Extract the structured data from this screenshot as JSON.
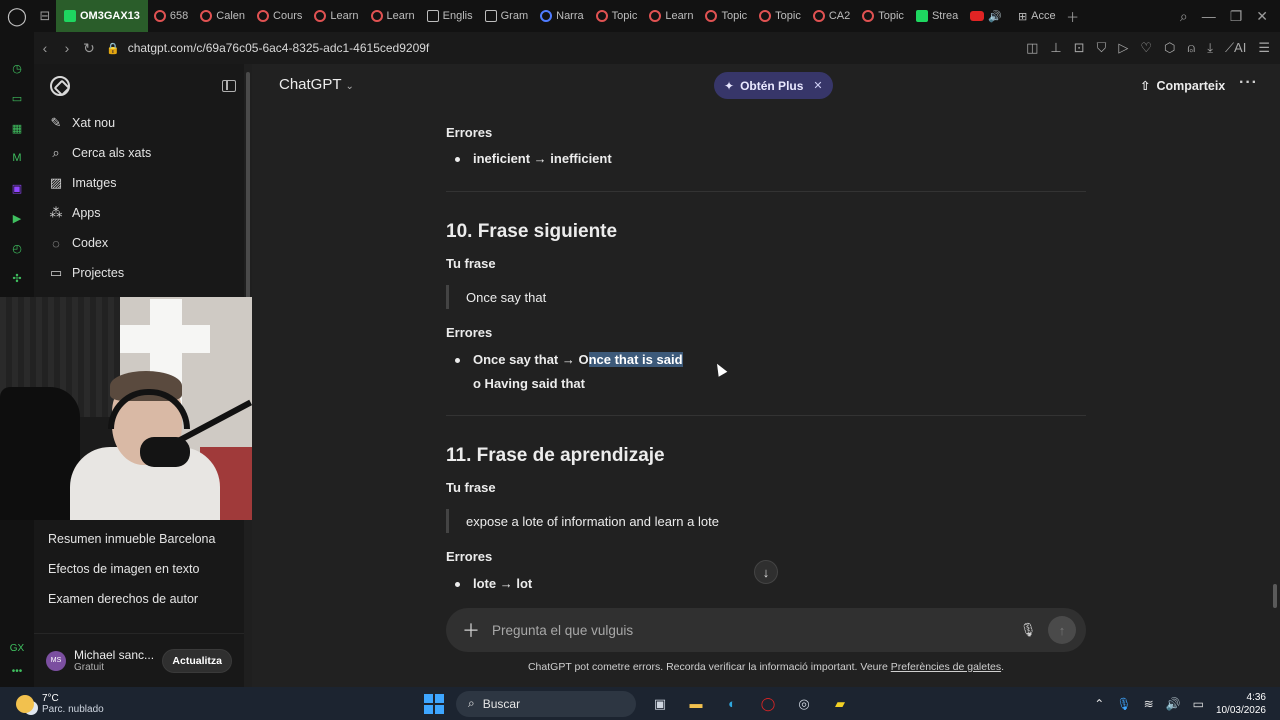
{
  "browser": {
    "tabs": [
      {
        "label": "OM3GAX13",
        "active": true
      },
      {
        "label": "658"
      },
      {
        "label": "Calen"
      },
      {
        "label": "Cours"
      },
      {
        "label": "Learn"
      },
      {
        "label": "Learn"
      },
      {
        "label": "Englis"
      },
      {
        "label": "Gram"
      },
      {
        "label": "Narra"
      },
      {
        "label": "Topic"
      },
      {
        "label": "Learn"
      },
      {
        "label": "Topic"
      },
      {
        "label": "Topic"
      },
      {
        "label": "CA2"
      },
      {
        "label": "Topic"
      },
      {
        "label": "Strea"
      },
      {
        "label": ""
      },
      {
        "label": "Acce"
      }
    ],
    "url": "chatgpt.com/c/69a76c05-6ac4-8325-adc1-4615ced9209f",
    "ai_label": "AI"
  },
  "sidebar": {
    "items": [
      {
        "icon": "new-chat-icon",
        "label": "Xat nou"
      },
      {
        "icon": "search-icon",
        "label": "Cerca als xats"
      },
      {
        "icon": "images-icon",
        "label": "Imatges"
      },
      {
        "icon": "apps-icon",
        "label": "Apps"
      },
      {
        "icon": "codex-icon",
        "label": "Codex"
      },
      {
        "icon": "projects-icon",
        "label": "Projectes"
      }
    ],
    "chats": [
      "Resumen inmueble Barcelona",
      "Efectos de imagen en texto",
      "Examen derechos de autor"
    ],
    "profile": {
      "initials": "MS",
      "name": "Michael sanc...",
      "plan": "Gratuit",
      "update_label": "Actualitza"
    }
  },
  "header": {
    "model": "ChatGPT",
    "plus_label": "Obtén Plus",
    "share_label": "Comparteix"
  },
  "content": {
    "errores_label": "Errores",
    "tu_frase_label": "Tu frase",
    "block0": {
      "error": "ineficient → inefficient"
    },
    "section10": {
      "title": "10. Frase siguiente",
      "phrase": "Once say that",
      "error_prefix": "Once say that → O",
      "error_highlight": "nce that is said",
      "alt": "o Having said that"
    },
    "section11": {
      "title": "11. Frase de aprendizaje",
      "phrase": "expose a lote of information and learn a lote",
      "error": "lote → lot"
    }
  },
  "composer": {
    "placeholder": "Pregunta el que vulguis",
    "disclaimer": "ChatGPT pot cometre errors. Recorda verificar la informació important. Veure ",
    "disclaimer_link": "Preferències de galetes",
    "disclaimer_end": "."
  },
  "taskbar": {
    "temp": "7°C",
    "weather": "Parc. nublado",
    "search": "Buscar",
    "time": "4:36",
    "date": "10/03/2026"
  }
}
